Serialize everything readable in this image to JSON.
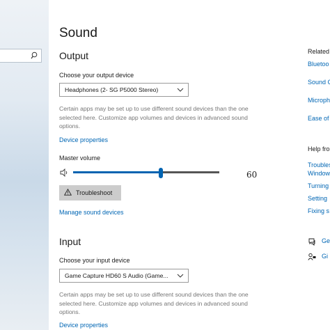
{
  "page": {
    "title": "Sound"
  },
  "search": {
    "icon": "search-icon"
  },
  "output": {
    "heading": "Output",
    "device_label": "Choose your output device",
    "device_value": "Headphones (2- SG P5000 Stereo)",
    "note_lines": [
      "Certain apps may be set up to use different sound devices than the one",
      "selected here. Customize app volumes and devices in advanced sound",
      "options."
    ],
    "device_properties": "Device properties",
    "master_volume_label": "Master volume",
    "volume": 60,
    "volume_text": "60",
    "troubleshoot": "Troubleshoot",
    "manage_devices": "Manage sound devices"
  },
  "input": {
    "heading": "Input",
    "device_label": "Choose your input device",
    "device_value": "Game Capture HD60 S Audio (Game...",
    "note_lines": [
      "Certain apps may be set up to use different sound devices than the one",
      "selected here. Customize app volumes and devices in advanced sound",
      "options."
    ],
    "device_properties": "Device properties"
  },
  "related": {
    "heading": "Related",
    "links": [
      "Bluetoo",
      "Sound C",
      "Microph",
      "Ease of"
    ]
  },
  "help": {
    "heading": "Help fro",
    "links": [
      "Troubles",
      "Window",
      "Turning",
      "Setting",
      "Fixing s"
    ]
  },
  "bottom_links": [
    "Ge",
    "Gi"
  ],
  "colors": {
    "accent": "#0063b1",
    "link": "#0066b4",
    "button": "#cccccc"
  }
}
